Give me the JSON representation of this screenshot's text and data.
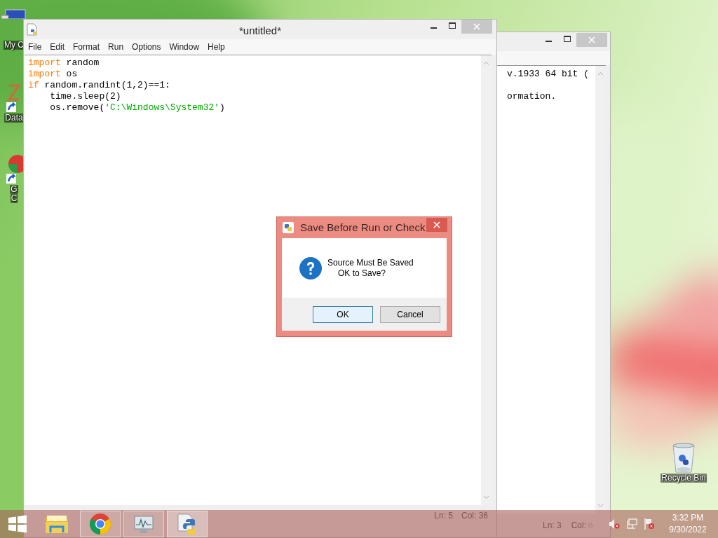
{
  "desktop_icons": [
    {
      "kind": "computer",
      "lines": [
        "My C"
      ]
    },
    {
      "kind": "shortcut",
      "lines": [
        "Data"
      ]
    },
    {
      "kind": "browser",
      "lines": [
        "G",
        "C"
      ]
    },
    {
      "kind": "recycle",
      "lines": [
        "Recycle Bin"
      ]
    }
  ],
  "shell_window": {
    "lines": [
      "v.1933 64 bit (",
      "ormation."
    ],
    "status": {
      "line": "Ln: 3",
      "col": "Col:"
    }
  },
  "editor_window": {
    "title": "*untitled*",
    "menu": [
      "File",
      "Edit",
      "Format",
      "Run",
      "Options",
      "Window",
      "Help"
    ],
    "code": [
      [
        {
          "kind": "keyword",
          "text": "import"
        },
        {
          "kind": "plain",
          "text": " random"
        }
      ],
      [
        {
          "kind": "keyword",
          "text": "import"
        },
        {
          "kind": "plain",
          "text": " os"
        }
      ],
      [
        {
          "kind": "keyword",
          "text": "if"
        },
        {
          "kind": "plain",
          "text": " random.randint(1,2)==1:"
        }
      ],
      [
        {
          "kind": "plain",
          "text": "    time.sleep(2)"
        }
      ],
      [
        {
          "kind": "plain",
          "text": "    os.remove("
        },
        {
          "kind": "string",
          "text": "'C:\\Windows\\System32'"
        },
        {
          "kind": "plain",
          "text": ")"
        }
      ]
    ],
    "status": {
      "line": "Ln: 5",
      "col": "Col: 36"
    }
  },
  "dialog": {
    "title": "Save Before Run or Check",
    "message": [
      "Source Must Be Saved",
      "OK to Save?"
    ],
    "buttons": [
      {
        "label": "OK",
        "selected": true
      },
      {
        "label": "Cancel",
        "selected": false
      }
    ]
  },
  "taskbar": {
    "apps": [
      {
        "kind": "start",
        "running": false,
        "selected": false
      },
      {
        "kind": "explorer",
        "running": false,
        "selected": false
      },
      {
        "kind": "chrome",
        "running": true,
        "selected": false
      },
      {
        "kind": "monitor",
        "running": true,
        "selected": false
      },
      {
        "kind": "python",
        "running": true,
        "selected": true
      }
    ],
    "time": "3:32 PM",
    "date": "9/30/2022"
  }
}
